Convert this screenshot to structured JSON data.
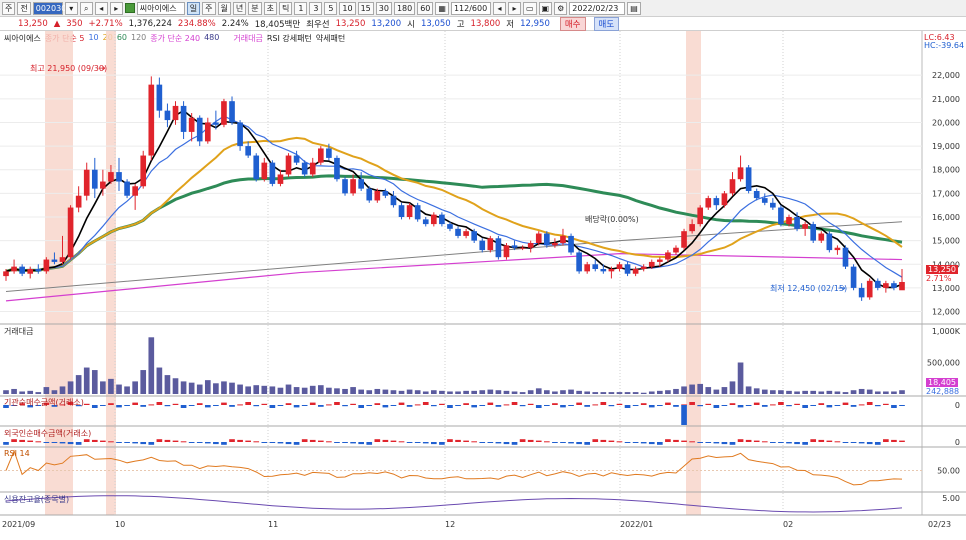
{
  "toolbar": {
    "buttons_left": [
      "주",
      "전"
    ],
    "stock_code": "002030",
    "stock_name": "씨아이에스",
    "period_selected": "일",
    "periods": [
      "주",
      "월",
      "년",
      "분",
      "초",
      "틱"
    ],
    "intervals": [
      "1",
      "3",
      "5",
      "10",
      "15",
      "30",
      "180",
      "60"
    ],
    "page_count": "112/600",
    "date": "2022/02/23"
  },
  "quote": {
    "price": "13,250",
    "change": "350",
    "change_pct": "+2.71%",
    "volume": "1,376,224",
    "volume_ratio": "234.88%",
    "turnover": "2.24%",
    "amount": "18,405백만",
    "prev_label": "최우선",
    "prev_value": "13,250",
    "ask": "13,200",
    "open_label": "시",
    "open": "13,050",
    "high_label": "고",
    "high": "13,800",
    "low_label": "저",
    "low": "12,950",
    "buy_label": "매수",
    "sell_label": "매도"
  },
  "legend": {
    "name": "씨아이에스",
    "ma_label": "종가 단순 5",
    "ma_periods": [
      "10",
      "20",
      "60",
      "120"
    ],
    "ma2_label": "종가 단순 240",
    "ma2_extra": "480",
    "vol_label": "거래대금",
    "rsi_label": "RSI 강세패턴",
    "bear_label": "약세패턴"
  },
  "annotations": {
    "high": "최고 21,950 (09/30)",
    "low": "최저 12,450 (02/15)",
    "dividend": "배당락(0.00%)",
    "lc": "LC:6.43",
    "hc": "HC:-39.64",
    "last_price_tag": "13,250",
    "last_pct_tag": "2.71%",
    "vol_tag_1": "18,405",
    "vol_tag_2": "242,888"
  },
  "panels": {
    "volume_title": "거래대금",
    "inst_title": "기관순매수금액(거래소)",
    "foreign_title": "외국인순매수금액(거래소)",
    "rsi_title": "RSI 14",
    "credit_title": "신용잔고율(종목별)"
  },
  "price_axis": [
    "22,000",
    "21,000",
    "20,000",
    "19,000",
    "18,000",
    "17,000",
    "16,000",
    "15,000",
    "14,000",
    "13,000",
    "12,000"
  ],
  "volume_axis": [
    "1,000K",
    "500,000"
  ],
  "inst_axis": [
    "0"
  ],
  "foreign_axis": [
    "0"
  ],
  "rsi_axis": [
    "50.00"
  ],
  "credit_axis": [
    "5.00"
  ],
  "date_axis": [
    "2021/09",
    "10",
    "11",
    "12",
    "2022/01",
    "02",
    "02/23"
  ],
  "colors": {
    "up": "#e0242c",
    "down": "#1f5fd0",
    "ma5": "#000000",
    "ma10": "#3b6fe0",
    "ma20": "#e0a21b",
    "ma60": "#2e8b57",
    "ma120": "#808080",
    "ma240": "#d43fd0",
    "highlight": "#f7c5b8",
    "volume": "#5b5b9e"
  },
  "chart_data": {
    "type": "candlestick",
    "ylim": [
      11600,
      22600
    ],
    "candles": [
      [
        13500,
        13800,
        13300,
        13700
      ],
      [
        13700,
        14200,
        13600,
        13900
      ],
      [
        13900,
        14000,
        13500,
        13600
      ],
      [
        13600,
        13900,
        13400,
        13800
      ],
      [
        13800,
        14000,
        13600,
        13700
      ],
      [
        13700,
        14300,
        13600,
        14200
      ],
      [
        14200,
        14500,
        14000,
        14100
      ],
      [
        14100,
        15200,
        14000,
        14300
      ],
      [
        14300,
        16500,
        14200,
        16400
      ],
      [
        16400,
        17300,
        16200,
        16900
      ],
      [
        16900,
        18300,
        16700,
        18000
      ],
      [
        18000,
        18500,
        16800,
        17200
      ],
      [
        17200,
        18000,
        16900,
        17500
      ],
      [
        17500,
        18200,
        17400,
        17900
      ],
      [
        17900,
        18500,
        17100,
        17500
      ],
      [
        17500,
        17600,
        16800,
        16900
      ],
      [
        16900,
        17400,
        16300,
        17300
      ],
      [
        17300,
        18800,
        17200,
        18600
      ],
      [
        18600,
        21950,
        18400,
        21600
      ],
      [
        21600,
        21900,
        20200,
        20500
      ],
      [
        20500,
        20800,
        19800,
        20100
      ],
      [
        20100,
        20900,
        19900,
        20700
      ],
      [
        20700,
        20900,
        19300,
        19600
      ],
      [
        19600,
        20400,
        19200,
        20200
      ],
      [
        20200,
        20300,
        19000,
        19200
      ],
      [
        19200,
        20200,
        19100,
        20000
      ],
      [
        20000,
        20500,
        19700,
        19900
      ],
      [
        19900,
        21000,
        19800,
        20900
      ],
      [
        20900,
        21100,
        19900,
        20000
      ],
      [
        20000,
        20100,
        18800,
        19000
      ],
      [
        19000,
        19200,
        18500,
        18600
      ],
      [
        18600,
        18700,
        17500,
        17600
      ],
      [
        17600,
        18500,
        17500,
        18300
      ],
      [
        18300,
        18400,
        17300,
        17400
      ],
      [
        17400,
        18000,
        17300,
        17800
      ],
      [
        17800,
        18700,
        17700,
        18600
      ],
      [
        18600,
        18800,
        18200,
        18300
      ],
      [
        18300,
        18400,
        17700,
        17800
      ],
      [
        17800,
        18500,
        17700,
        18300
      ],
      [
        18300,
        19000,
        18200,
        18900
      ],
      [
        18900,
        19100,
        18400,
        18500
      ],
      [
        18500,
        18600,
        17500,
        17600
      ],
      [
        17600,
        17700,
        16900,
        17000
      ],
      [
        17000,
        17800,
        16900,
        17600
      ],
      [
        17600,
        17900,
        17100,
        17200
      ],
      [
        17200,
        17300,
        16600,
        16700
      ],
      [
        16700,
        17200,
        16600,
        17100
      ],
      [
        17100,
        17200,
        16800,
        16900
      ],
      [
        16900,
        17100,
        16400,
        16500
      ],
      [
        16500,
        16600,
        15900,
        16000
      ],
      [
        16000,
        16600,
        15900,
        16500
      ],
      [
        16500,
        16600,
        15800,
        15900
      ],
      [
        15900,
        16000,
        15600,
        15700
      ],
      [
        15700,
        16200,
        15600,
        16100
      ],
      [
        16100,
        16200,
        15600,
        15700
      ],
      [
        15700,
        15800,
        15400,
        15500
      ],
      [
        15500,
        15600,
        15100,
        15200
      ],
      [
        15200,
        15500,
        15100,
        15400
      ],
      [
        15400,
        15500,
        14900,
        15000
      ],
      [
        15000,
        15100,
        14500,
        14600
      ],
      [
        14600,
        15200,
        14500,
        15100
      ],
      [
        15100,
        15200,
        14200,
        14300
      ],
      [
        14300,
        14900,
        14200,
        14800
      ],
      [
        14800,
        15000,
        14600,
        14700
      ],
      [
        14700,
        14800,
        14600,
        14700
      ],
      [
        14700,
        15000,
        14500,
        14900
      ],
      [
        14900,
        15400,
        14800,
        15300
      ],
      [
        15300,
        15400,
        14700,
        14800
      ],
      [
        14800,
        15100,
        14700,
        14900
      ],
      [
        14900,
        15500,
        14800,
        15200
      ],
      [
        15200,
        15300,
        14400,
        14500
      ],
      [
        14500,
        14600,
        13600,
        13700
      ],
      [
        13700,
        14100,
        13600,
        14000
      ],
      [
        14000,
        14200,
        13700,
        13800
      ],
      [
        13800,
        14000,
        13600,
        13700
      ],
      [
        13700,
        13900,
        13400,
        13800
      ],
      [
        13800,
        14100,
        13700,
        14000
      ],
      [
        14000,
        14100,
        13500,
        13600
      ],
      [
        13600,
        13900,
        13500,
        13800
      ],
      [
        13800,
        14000,
        13700,
        13900
      ],
      [
        13900,
        14200,
        13800,
        14100
      ],
      [
        14100,
        14300,
        13900,
        14200
      ],
      [
        14200,
        14600,
        14100,
        14500
      ],
      [
        14500,
        14800,
        14400,
        14700
      ],
      [
        14700,
        15500,
        14600,
        15400
      ],
      [
        15400,
        15900,
        15300,
        15700
      ],
      [
        15700,
        16500,
        15600,
        16400
      ],
      [
        16400,
        16900,
        16300,
        16800
      ],
      [
        16800,
        16900,
        16300,
        16500
      ],
      [
        16500,
        17100,
        16400,
        17000
      ],
      [
        17000,
        17900,
        16900,
        17600
      ],
      [
        17600,
        18600,
        17500,
        18100
      ],
      [
        18100,
        18200,
        17000,
        17100
      ],
      [
        17100,
        17200,
        16700,
        16800
      ],
      [
        16800,
        17000,
        16500,
        16600
      ],
      [
        16600,
        16800,
        16300,
        16400
      ],
      [
        16400,
        16500,
        15600,
        15700
      ],
      [
        15700,
        16100,
        15600,
        16000
      ],
      [
        16000,
        16200,
        15400,
        15500
      ],
      [
        15500,
        15800,
        15200,
        15700
      ],
      [
        15700,
        15800,
        14900,
        15000
      ],
      [
        15000,
        15400,
        14900,
        15300
      ],
      [
        15300,
        15400,
        14500,
        14600
      ],
      [
        14600,
        14800,
        14400,
        14700
      ],
      [
        14700,
        14800,
        13800,
        13900
      ],
      [
        13900,
        14000,
        12900,
        13000
      ],
      [
        13000,
        13200,
        12450,
        12600
      ],
      [
        12600,
        13400,
        12500,
        13300
      ],
      [
        13300,
        13400,
        12900,
        13000
      ],
      [
        13000,
        13300,
        12800,
        13200
      ],
      [
        13200,
        13300,
        12900,
        13000
      ],
      [
        12900,
        13800,
        12950,
        13250
      ]
    ],
    "volume": [
      60,
      80,
      40,
      50,
      30,
      110,
      60,
      120,
      200,
      300,
      420,
      380,
      200,
      240,
      150,
      120,
      200,
      380,
      900,
      420,
      300,
      250,
      200,
      180,
      150,
      220,
      170,
      200,
      180,
      150,
      120,
      140,
      130,
      120,
      100,
      150,
      110,
      100,
      130,
      140,
      100,
      90,
      80,
      110,
      70,
      60,
      80,
      70,
      60,
      50,
      70,
      60,
      40,
      60,
      50,
      40,
      40,
      50,
      50,
      60,
      70,
      60,
      50,
      40,
      30,
      60,
      90,
      60,
      40,
      60,
      70,
      50,
      40,
      30,
      30,
      30,
      30,
      30,
      30,
      20,
      40,
      50,
      60,
      80,
      120,
      150,
      160,
      110,
      70,
      110,
      200,
      500,
      120,
      90,
      70,
      60,
      60,
      50,
      40,
      50,
      50,
      40,
      50,
      40,
      30,
      60,
      80,
      70,
      40,
      40,
      40,
      60
    ]
  }
}
